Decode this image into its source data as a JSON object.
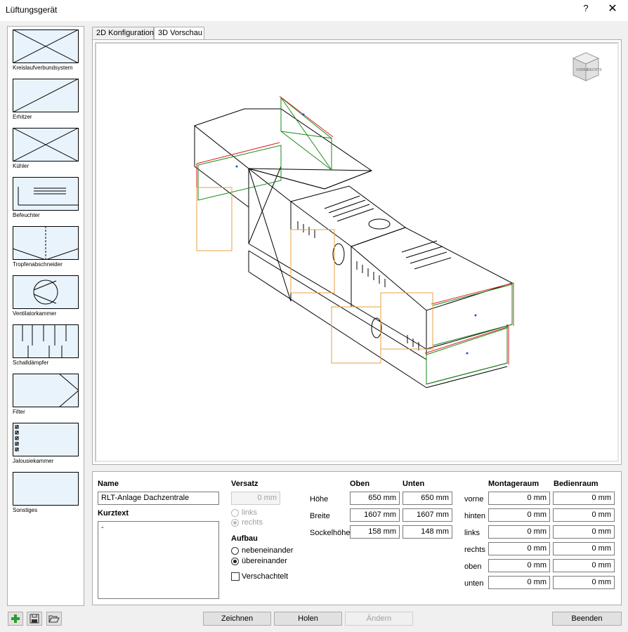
{
  "window": {
    "title": "Lüftungsgerät",
    "help": "?",
    "close": "✕"
  },
  "palette": [
    {
      "label": "Kreislaufverbundsystem",
      "icon": "crossed-box-icon"
    },
    {
      "label": "Erhitzer",
      "icon": "diagonal-box-icon"
    },
    {
      "label": "Kühler",
      "icon": "crossed-box-icon"
    },
    {
      "label": "Befeuchter",
      "icon": "humidifier-icon"
    },
    {
      "label": "Tropfenabschneider",
      "icon": "droplet-separator-icon"
    },
    {
      "label": "Ventilatorkammer",
      "icon": "fan-icon"
    },
    {
      "label": "Schalldämpfer",
      "icon": "silencer-icon"
    },
    {
      "label": "Filter",
      "icon": "filter-icon"
    },
    {
      "label": "Jalousiekammer",
      "icon": "louvre-icon"
    },
    {
      "label": "Sonstiges",
      "icon": "empty-box-icon"
    }
  ],
  "tabs": [
    {
      "label": "2D Konfiguration",
      "active": false
    },
    {
      "label": "3D Vorschau",
      "active": true
    }
  ],
  "viewcube": {
    "front": "RECHTS",
    "left": "VORNE",
    "top": "OBEN"
  },
  "form": {
    "name_label": "Name",
    "name_value": "RLT-Anlage Dachzentrale",
    "kurztext_label": "Kurztext",
    "kurztext_value": "-",
    "versatz_label": "Versatz",
    "versatz_value": "0 mm",
    "versatz_options": [
      "links",
      "rechts"
    ],
    "aufbau_label": "Aufbau",
    "aufbau_options": [
      "nebeneinander",
      "übereinander"
    ],
    "verschachtelt_label": "Verschachtelt",
    "dims": {
      "col_oben": "Oben",
      "col_unten": "Unten",
      "rows": [
        {
          "label": "Höhe",
          "oben": "650 mm",
          "unten": "650 mm"
        },
        {
          "label": "Breite",
          "oben": "1607 mm",
          "unten": "1607 mm"
        },
        {
          "label": "Sockelhöhe",
          "oben": "158 mm",
          "unten": "148 mm"
        }
      ]
    },
    "rooms": {
      "col_montage": "Montageraum",
      "col_bedien": "Bedienraum",
      "rows": [
        {
          "label": "vorne",
          "montage": "0 mm",
          "bedien": "0 mm"
        },
        {
          "label": "hinten",
          "montage": "0 mm",
          "bedien": "0 mm"
        },
        {
          "label": "links",
          "montage": "0 mm",
          "bedien": "0 mm"
        },
        {
          "label": "rechts",
          "montage": "0 mm",
          "bedien": "0 mm"
        },
        {
          "label": "oben",
          "montage": "0 mm",
          "bedien": "0 mm"
        },
        {
          "label": "unten",
          "montage": "0 mm",
          "bedien": "0 mm"
        }
      ]
    }
  },
  "footer": {
    "zeichnen": "Zeichnen",
    "holen": "Holen",
    "aendern": "Ändern",
    "beenden": "Beenden"
  },
  "colors": {
    "accent": "#0078d7",
    "add_green": "#2e9a2e"
  }
}
